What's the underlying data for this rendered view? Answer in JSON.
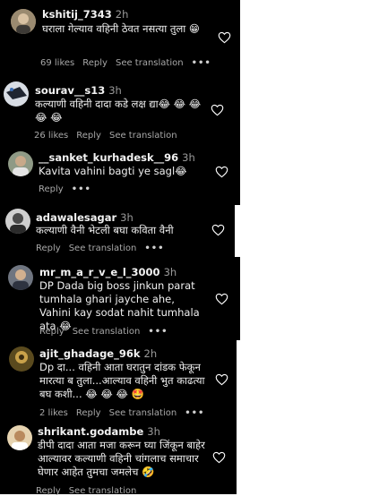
{
  "comments": [
    {
      "username": "kshitij_7343",
      "time": "2h",
      "text": "घराला गेल्याव वहिनी ठेवत नसत्या तुला 😁",
      "likes": "69 likes",
      "reply": "Reply",
      "see_translation": "See translation",
      "more": "•••"
    },
    {
      "username": "sourav__s13",
      "time": "3h",
      "text": "कल्याणी वहिनी दादा कडे लक्ष द्या😂 😂 😂 😂 😂",
      "likes": "26 likes",
      "reply": "Reply",
      "see_translation": "See translation",
      "more": ""
    },
    {
      "username": "__sanket_kurhadesk__96",
      "time": "3h",
      "text": "Kavita vahini bagti ye sagl😂",
      "likes": "",
      "reply": "Reply",
      "see_translation": "",
      "more": "•••"
    },
    {
      "username": "adawalesagar",
      "time": "3h",
      "text": "कल्याणी वैनी भेटली बघा कविता वैनी",
      "likes": "",
      "reply": "Reply",
      "see_translation": "See translation",
      "more": "•••"
    },
    {
      "username": "mr_m_a_r_v_e_l_3000",
      "time": "3h",
      "text": "DP Dada big boss jinkun parat tumhala ghari jayche ahe, Vahini kay sodat nahit tumhala ata 😂",
      "likes": "",
      "reply": "Reply",
      "see_translation": "See translation",
      "more": "•••"
    },
    {
      "username": "ajit_ghadage_96k",
      "time": "2h",
      "text": "Dp दा... वहिनी आता घरातुन दांडक फेकून मारत्या ब तुला...आल्याव वहिनी भुत काढत्या बघ कशी... 😂 😂 😂 🤩",
      "likes": "2 likes",
      "reply": "Reply",
      "see_translation": "See translation",
      "more": "•••"
    },
    {
      "username": "shrikant.godambe",
      "time": "3h",
      "text": "डीपी दादा आता मजा करून घ्या जिंकून बाहेर आल्यावर कल्याणी वहिनी चांगलाच समाचार घेणार आहेत तुमचा जमलेच 🤣",
      "likes": "",
      "reply": "Reply",
      "see_translation": "See translation",
      "more": ""
    }
  ],
  "colors": {
    "background": "#000000",
    "text": "#f0f0f0",
    "muted": "#a8a8a8",
    "page": "#ffffff"
  },
  "icons": {
    "like": "heart-outline-icon",
    "avatar": "user-avatar-icon"
  }
}
